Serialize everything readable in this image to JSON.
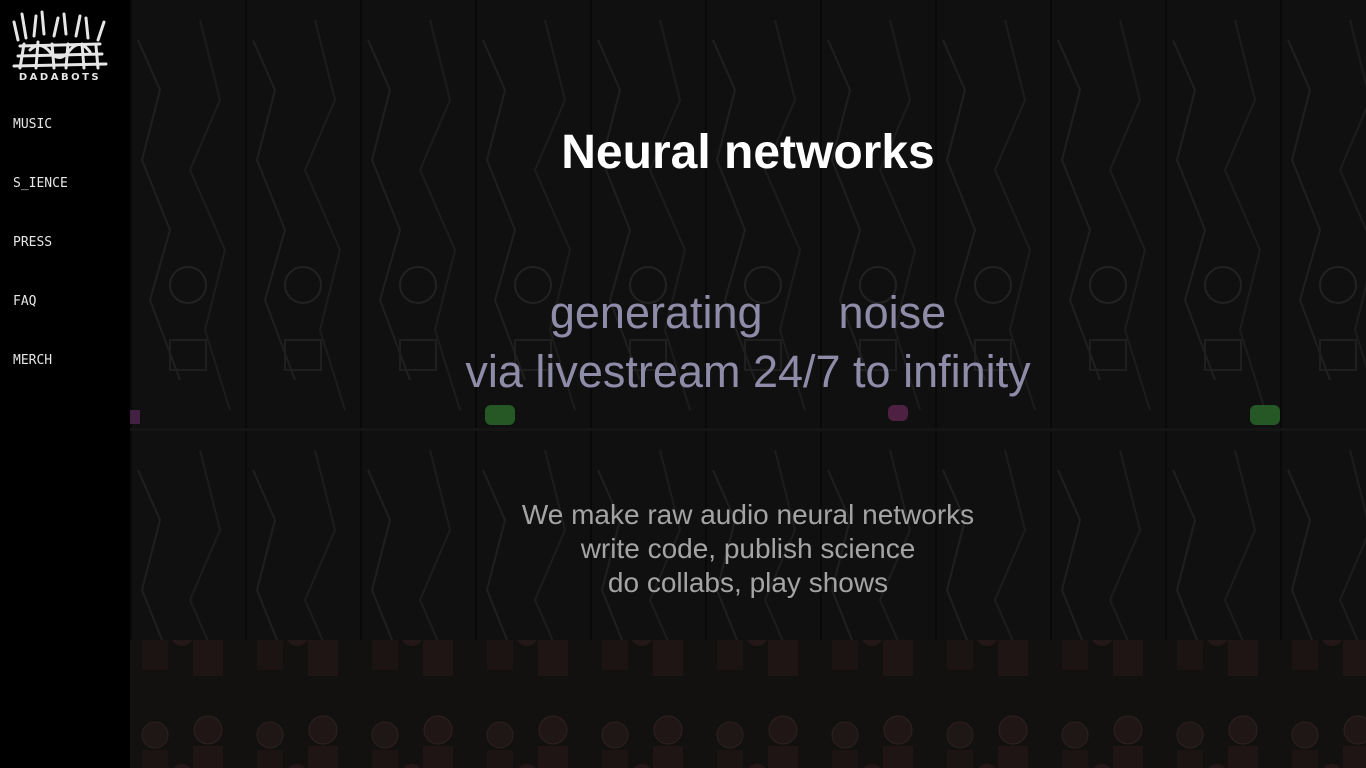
{
  "brand": {
    "name": "DADABOTS"
  },
  "nav": {
    "items": [
      {
        "label": "MUSIC"
      },
      {
        "label": "S_IENCE"
      },
      {
        "label": "PRESS"
      },
      {
        "label": "FAQ"
      },
      {
        "label": "MERCH"
      }
    ]
  },
  "hero": {
    "title": "Neural networks",
    "tagline_word1": "generating",
    "tagline_word2": "noise",
    "tagline_line2": "via livestream 24/7 to infinity",
    "desc_line1": "We make raw audio neural networks",
    "desc_line2": "write code, publish science",
    "desc_line3": "do collabs, play shows"
  },
  "colors": {
    "background": "#141414",
    "title": "#ffffff",
    "tagline": "#8e8ca8",
    "desc": "#a4a4a4",
    "nav_text": "#e6e6e6"
  },
  "icons": {
    "logo": "dadabots-logo-icon"
  }
}
